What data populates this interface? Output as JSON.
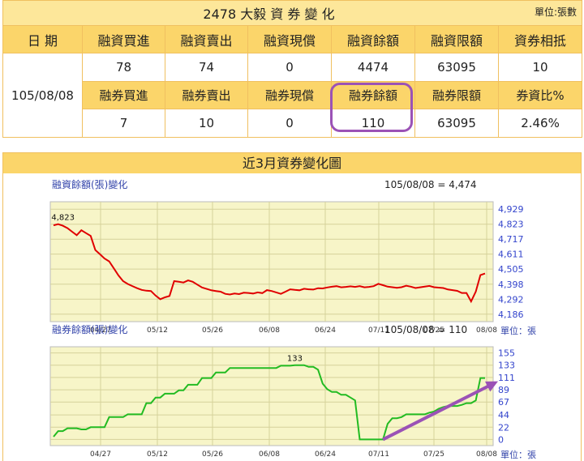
{
  "table": {
    "title": "2478 大毅 資 券 變 化",
    "unit": "單位:張數",
    "date_header": "日 期",
    "date_value": "105/08/08",
    "row1_headers": [
      "融資買進",
      "融資賣出",
      "融資現償",
      "融資餘額",
      "融資限額",
      "資券相抵"
    ],
    "row1_values": [
      "78",
      "74",
      "0",
      "4474",
      "63095",
      "10"
    ],
    "row2_headers": [
      "融券買進",
      "融券賣出",
      "融券現償",
      "融券餘額",
      "融券限額",
      "券資比%"
    ],
    "row2_values": [
      "7",
      "10",
      "0",
      "110",
      "63095",
      "2.46%"
    ]
  },
  "chart_section_title": "近3月資券變化圖",
  "colors": {
    "header_bg": "#fbd56a",
    "plot_bg": "#f7f5c8",
    "margin_line": "#e00000",
    "short_line": "#22bb22",
    "highlight": "#9b52b6"
  },
  "chart_data": [
    {
      "type": "line",
      "title": "融資餘額(張)變化",
      "summary": "105/08/08 = 4,474",
      "unit_label": "單位：張",
      "x_ticks": [
        "04/27",
        "05/12",
        "05/26",
        "06/08",
        "06/24",
        "07/11",
        "07/25",
        "08/08"
      ],
      "y_ticks": [
        "4,929",
        "4,823",
        "4,717",
        "4,611",
        "4,505",
        "4,398",
        "4,292",
        "4,186"
      ],
      "ylim": [
        4133,
        4982
      ],
      "peak_label": "4,823",
      "series": [
        {
          "values": [
            4815,
            4823,
            4812,
            4795,
            4770,
            4745,
            4780,
            4760,
            4740,
            4640,
            4610,
            4580,
            4560,
            4510,
            4460,
            4420,
            4400,
            4385,
            4370,
            4358,
            4352,
            4350,
            4318,
            4292,
            4305,
            4315,
            4420,
            4415,
            4410,
            4425,
            4415,
            4395,
            4375,
            4365,
            4355,
            4350,
            4345,
            4330,
            4325,
            4332,
            4328,
            4338,
            4336,
            4332,
            4340,
            4335,
            4356,
            4350,
            4340,
            4330,
            4345,
            4362,
            4358,
            4355,
            4366,
            4362,
            4360,
            4370,
            4368,
            4375,
            4380,
            4384,
            4376,
            4379,
            4383,
            4379,
            4385,
            4376,
            4379,
            4384,
            4401,
            4391,
            4381,
            4377,
            4373,
            4377,
            4387,
            4381,
            4371,
            4376,
            4381,
            4386,
            4377,
            4374,
            4371,
            4361,
            4356,
            4351,
            4336,
            4336,
            4276,
            4346,
            4463,
            4474
          ]
        }
      ]
    },
    {
      "type": "line",
      "title": "融券餘額(張)變化",
      "summary": "105/08/08 = 110",
      "unit_label": "單位：張",
      "x_ticks": [
        "04/27",
        "05/12",
        "05/26",
        "06/08",
        "06/24",
        "07/11",
        "07/25",
        "08/08"
      ],
      "y_ticks": [
        "155",
        "133",
        "111",
        "89",
        "67",
        "44",
        "22",
        "0"
      ],
      "ylim": [
        -11,
        166
      ],
      "peak_label": "133",
      "series": [
        {
          "values": [
            5,
            15,
            15,
            20,
            20,
            20,
            18,
            18,
            22,
            22,
            22,
            22,
            40,
            40,
            40,
            40,
            45,
            45,
            45,
            45,
            65,
            65,
            75,
            75,
            82,
            82,
            82,
            88,
            88,
            98,
            98,
            98,
            110,
            110,
            110,
            120,
            120,
            120,
            128,
            128,
            128,
            128,
            128,
            128,
            128,
            128,
            128,
            128,
            128,
            132,
            132,
            132,
            133,
            133,
            133,
            130,
            130,
            125,
            100,
            90,
            85,
            85,
            80,
            80,
            75,
            70,
            0,
            0,
            0,
            0,
            0,
            0,
            28,
            38,
            38,
            40,
            45,
            45,
            45,
            45,
            45,
            48,
            50,
            55,
            58,
            60,
            60,
            60,
            62,
            65,
            65,
            70,
            110,
            110
          ]
        }
      ]
    }
  ]
}
